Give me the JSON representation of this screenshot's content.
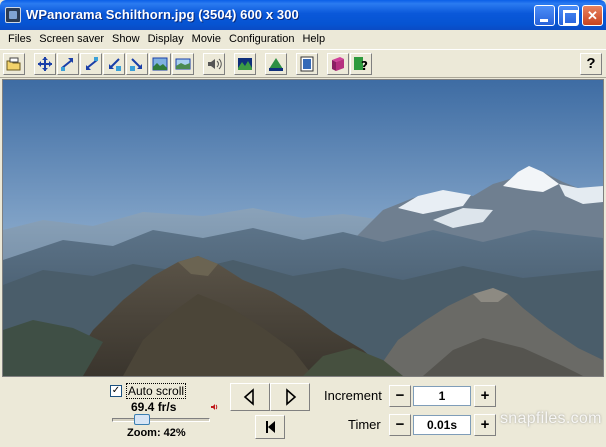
{
  "window": {
    "title": "WPanorama  Schilthorn.jpg   (3504) 600 x 300",
    "minimize_label": "",
    "maximize_label": "",
    "close_label": "✕"
  },
  "menu": [
    "Files",
    "Screen saver",
    "Show",
    "Display",
    "Movie",
    "Configuration",
    "Help"
  ],
  "toolbar": {
    "tools": [
      "open-icon",
      "zoom-fit-icon",
      "zoom-in-icon",
      "zoom-out-icon",
      "shrink-icon",
      "expand-icon",
      "fit-height-icon",
      "fit-width-icon",
      "sound-icon",
      "panorama-icon",
      "panorama-flip-icon",
      "frame-icon",
      "book-icon",
      "help-topic-icon",
      "help-icon"
    ],
    "help_label": "?"
  },
  "controls": {
    "auto_scroll_label": "Auto scroll",
    "auto_scroll_checked": true,
    "auto_scroll_mark": "✓",
    "fps": "69.4 fr/s",
    "zoom": "Zoom: 42%",
    "zoom_slider_fraction": 0.27,
    "increment_label": "Increment",
    "increment_value": "1",
    "timer_label": "Timer",
    "timer_value": "0.01s",
    "minus": "−",
    "plus": "+"
  },
  "watermark": "snapfiles.com",
  "colors": {
    "titlebar": "#0A58DA",
    "sky_top": "#3E6CA3",
    "sky_bottom": "#BFD0DE",
    "panel": "#ECE9D8"
  }
}
